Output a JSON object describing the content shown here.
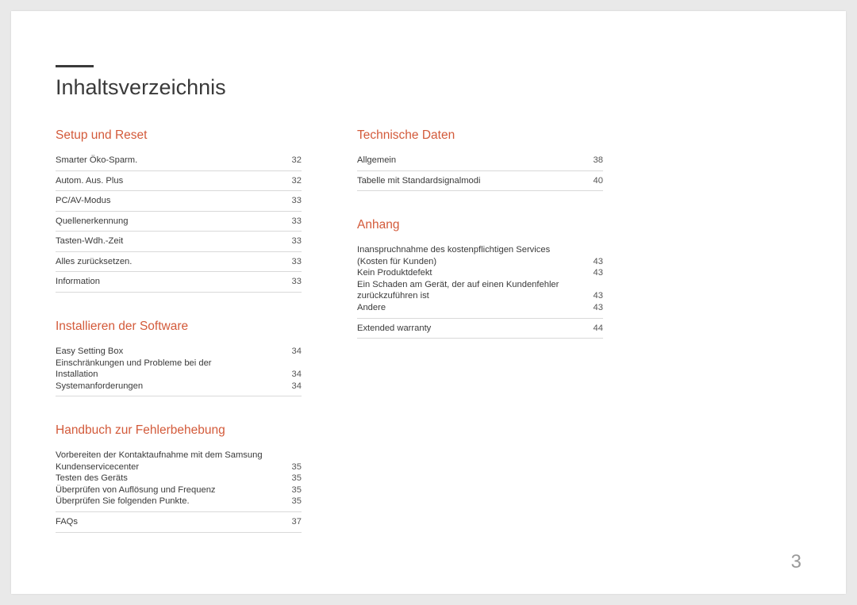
{
  "title": "Inhaltsverzeichnis",
  "pageNumber": "3",
  "col1": {
    "s1": {
      "title": "Setup und Reset",
      "e0": {
        "label": "Smarter Öko-Sparm.",
        "page": "32"
      },
      "e1": {
        "label": "Autom. Aus. Plus",
        "page": "32"
      },
      "e2": {
        "label": "PC/AV-Modus",
        "page": "33"
      },
      "e3": {
        "label": "Quellenerkennung",
        "page": "33"
      },
      "e4": {
        "label": "Tasten-Wdh.-Zeit",
        "page": "33"
      },
      "e5": {
        "label": "Alles zurücksetzen.",
        "page": "33"
      },
      "e6": {
        "label": "Information",
        "page": "33"
      }
    },
    "s2": {
      "title": "Installieren der Software",
      "g0": {
        "head": {
          "label": "Easy Setting Box",
          "page": "34"
        },
        "sub0": {
          "prefix": "Einschränkungen und Probleme bei der",
          "label": "Installation",
          "page": "34"
        },
        "sub1": {
          "label": "Systemanforderungen",
          "page": "34"
        }
      }
    },
    "s3": {
      "title": "Handbuch zur Fehlerbehebung",
      "g0": {
        "sub0": {
          "prefix": "Vorbereiten der Kontaktaufnahme mit dem Samsung",
          "label": "Kundenservicecenter",
          "page": "35"
        },
        "sub1": {
          "label": "Testen des Geräts",
          "page": "35"
        },
        "sub2": {
          "label": "Überprüfen von Auflösung und Frequenz",
          "page": "35"
        },
        "sub3": {
          "label": "Überprüfen Sie folgenden Punkte.",
          "page": "35"
        }
      },
      "e1": {
        "label": "FAQs",
        "page": "37"
      }
    }
  },
  "col2": {
    "s1": {
      "title": "Technische Daten",
      "e0": {
        "label": "Allgemein",
        "page": "38"
      },
      "e1": {
        "label": "Tabelle mit Standardsignalmodi",
        "page": "40"
      }
    },
    "s2": {
      "title": "Anhang",
      "g0": {
        "sub0": {
          "prefix": "Inanspruchnahme des kostenpflichtigen Services",
          "label": "(Kosten für Kunden)",
          "page": "43"
        },
        "sub1": {
          "label": "Kein Produktdefekt",
          "page": "43"
        },
        "sub2": {
          "prefix": "Ein Schaden am Gerät, der auf einen Kundenfehler",
          "label": "zurückzuführen ist",
          "page": "43"
        },
        "sub3": {
          "label": "Andere",
          "page": "43"
        }
      },
      "e1": {
        "label": "Extended warranty",
        "page": "44"
      }
    }
  }
}
